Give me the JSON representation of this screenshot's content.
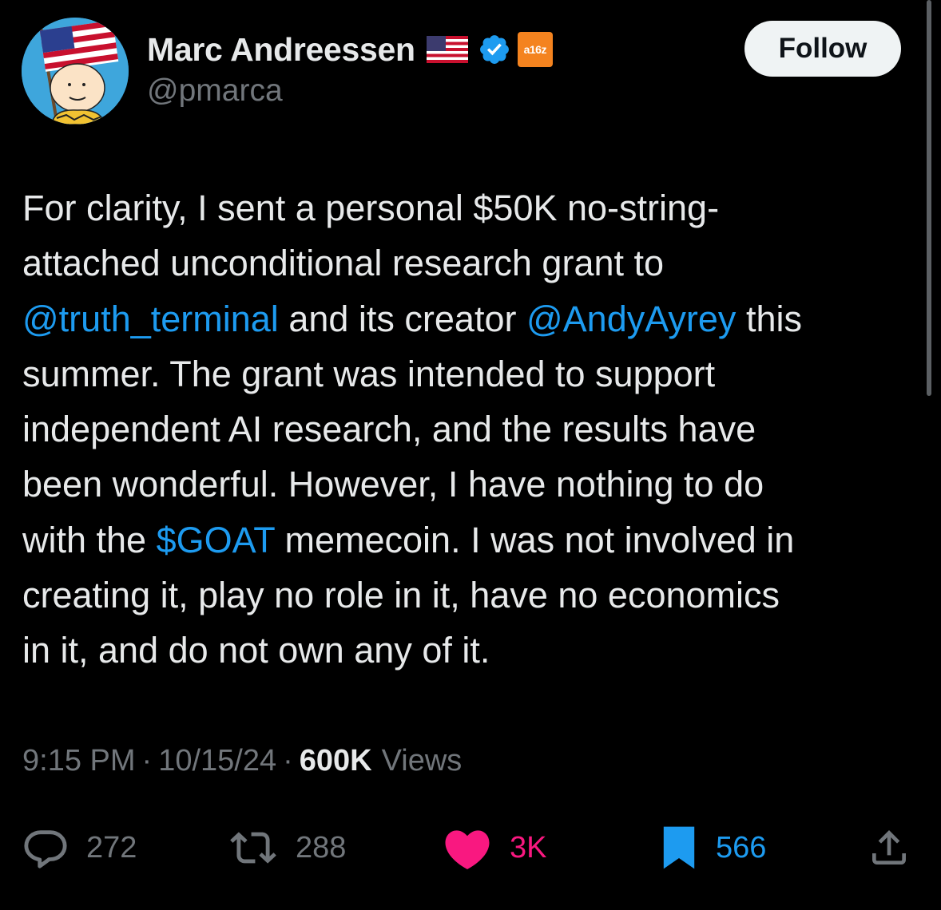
{
  "author": {
    "display_name": "Marc Andreessen",
    "handle": "@pmarca",
    "flag_icon": "us-flag-icon",
    "verified_icon": "verified-badge-icon",
    "affiliation_label": "a16z",
    "affiliation_color": "#f4831f"
  },
  "follow_label": "Follow",
  "tweet": {
    "lines": [
      [
        {
          "t": "For clarity, I sent a personal $50K no-string-"
        }
      ],
      [
        {
          "t": "attached unconditional research grant to"
        }
      ],
      [
        {
          "t": "@truth_terminal",
          "link": true
        },
        {
          "t": " and its creator "
        },
        {
          "t": "@AndyAyrey",
          "link": true
        },
        {
          "t": " this"
        }
      ],
      [
        {
          "t": "summer. The grant was intended to support"
        }
      ],
      [
        {
          "t": "independent AI research, and the results have"
        }
      ],
      [
        {
          "t": "been wonderful. However, I have nothing to do"
        }
      ],
      [
        {
          "t": "with the "
        },
        {
          "t": "$GOAT",
          "link": true
        },
        {
          "t": " memecoin. I was not involved in"
        }
      ],
      [
        {
          "t": "creating it, play no role in it, have no economics"
        }
      ],
      [
        {
          "t": "in it, and do not own any of it."
        }
      ]
    ]
  },
  "meta": {
    "time": "9:15 PM",
    "date": "10/15/24",
    "separator": "·",
    "views_count": "600K",
    "views_label": "Views"
  },
  "actions": {
    "replies": "272",
    "reposts": "288",
    "likes": "3K",
    "bookmarks": "566"
  },
  "colors": {
    "background": "#000000",
    "text": "#e7e9ea",
    "muted": "#71767b",
    "link": "#1d9bf0",
    "like": "#f91880",
    "bookmark": "#1d9bf0"
  }
}
